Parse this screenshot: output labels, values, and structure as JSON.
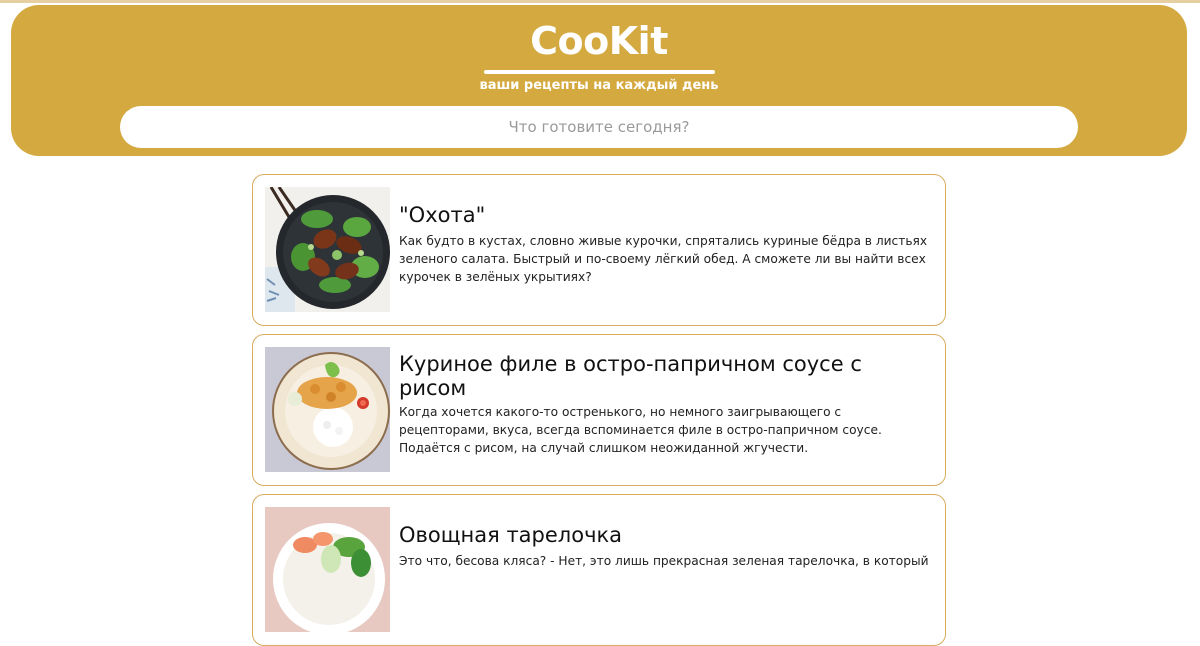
{
  "header": {
    "logo": "CooKit",
    "tagline": "ваши рецепты на каждый день",
    "search_placeholder": "Что готовите сегодня?"
  },
  "colors": {
    "header_bg": "#d4a940",
    "card_border": "#d8ad5e"
  },
  "recipes": [
    {
      "title": "\"Охота\"",
      "description": "Как будто в кустах, словно живые курочки, спрятались куриные бёдра в листьях зеленого салата. Быстрый и по-своему лёгкий обед. А сможете ли вы найти всех курочек в зелёных укрытиях?",
      "image": "chicken-thighs-salad-photo"
    },
    {
      "title": "Куриное филе в остро-папричном соусе с рисом",
      "description": "Когда хочется какого-то остренького, но немного заигрывающего с рецепторами, вкуса, всегда вспоминается филе в остро-папричном соусе. Подаётся с рисом, на случай слишком неожиданной жгучести.",
      "image": "chicken-rice-plate-photo"
    },
    {
      "title": "Овощная тарелочка",
      "description": "Это что, бесова кляса? - Нет, это лишь прекрасная зеленая тарелочка, в который",
      "image": "vegetable-bowl-photo"
    }
  ]
}
